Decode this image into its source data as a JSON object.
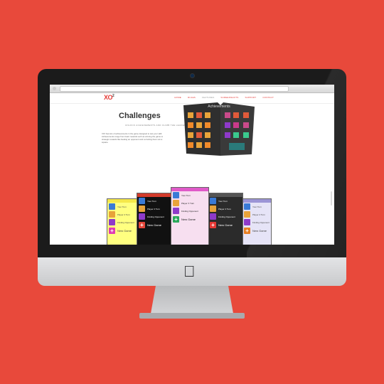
{
  "site": {
    "logo": "XO",
    "logo_sup": "2",
    "nav": [
      {
        "label": "HOME",
        "active": false
      },
      {
        "label": "RULES",
        "active": false
      },
      {
        "label": "FEATURES",
        "active": true
      },
      {
        "label": "SCREENSHOTS",
        "active": false
      },
      {
        "label": "SUPPORT",
        "active": false
      },
      {
        "label": "CONTACT",
        "active": false
      }
    ]
  },
  "hero": {
    "title": "Challenges",
    "subtitle": "UNLOCK ACHIEVEMENTS AND CLIMB THE LEADERBOARDS",
    "body": "XO² has lots of achievements in the game designed to test your skill. Achievements range from basic rewards such as winning the game to strategic rewards like beating an opponent and not letting them win a square."
  },
  "book": {
    "title": "Achievements"
  },
  "phones": [
    {
      "bg": "#ffff80",
      "hdr": "#f5e84a",
      "text": "#444",
      "rows": [
        "Your Turn",
        "Player 2 Turn",
        "Finding Opponent"
      ],
      "new_game": "New Game",
      "plus": "#e03bb5"
    },
    {
      "bg": "#111111",
      "hdr": "#d23b2b",
      "text": "#fff",
      "rows": [
        "Your Turn",
        "Player 2 Turn",
        "Finding Opponent"
      ],
      "new_game": "New Game",
      "plus": "#e5473a"
    },
    {
      "bg": "#f7dff0",
      "hdr": "#e05ac9",
      "text": "#222",
      "rows": [
        "Your Turn",
        "Player X Turn",
        "Finding Opponent"
      ],
      "new_game": "New Game",
      "plus": "#2aa85a"
    },
    {
      "bg": "#2b2b2b",
      "hdr": "#555555",
      "text": "#fff",
      "rows": [
        "Your Turn",
        "Player 2 Turn",
        "Finding Opponent"
      ],
      "new_game": "New Game",
      "plus": "#e53935"
    },
    {
      "bg": "#e6e4f7",
      "hdr": "#9c95d6",
      "text": "#444",
      "rows": [
        "Your Turn",
        "Player 2 Turn",
        "Finding Opponent"
      ],
      "new_game": "New Game",
      "plus": "#e67e22"
    }
  ],
  "colors": {
    "background": "#e8493b",
    "accent": "#e53935"
  },
  "icons": {
    "apple": "apple-logo-icon",
    "camera": "camera-icon"
  }
}
